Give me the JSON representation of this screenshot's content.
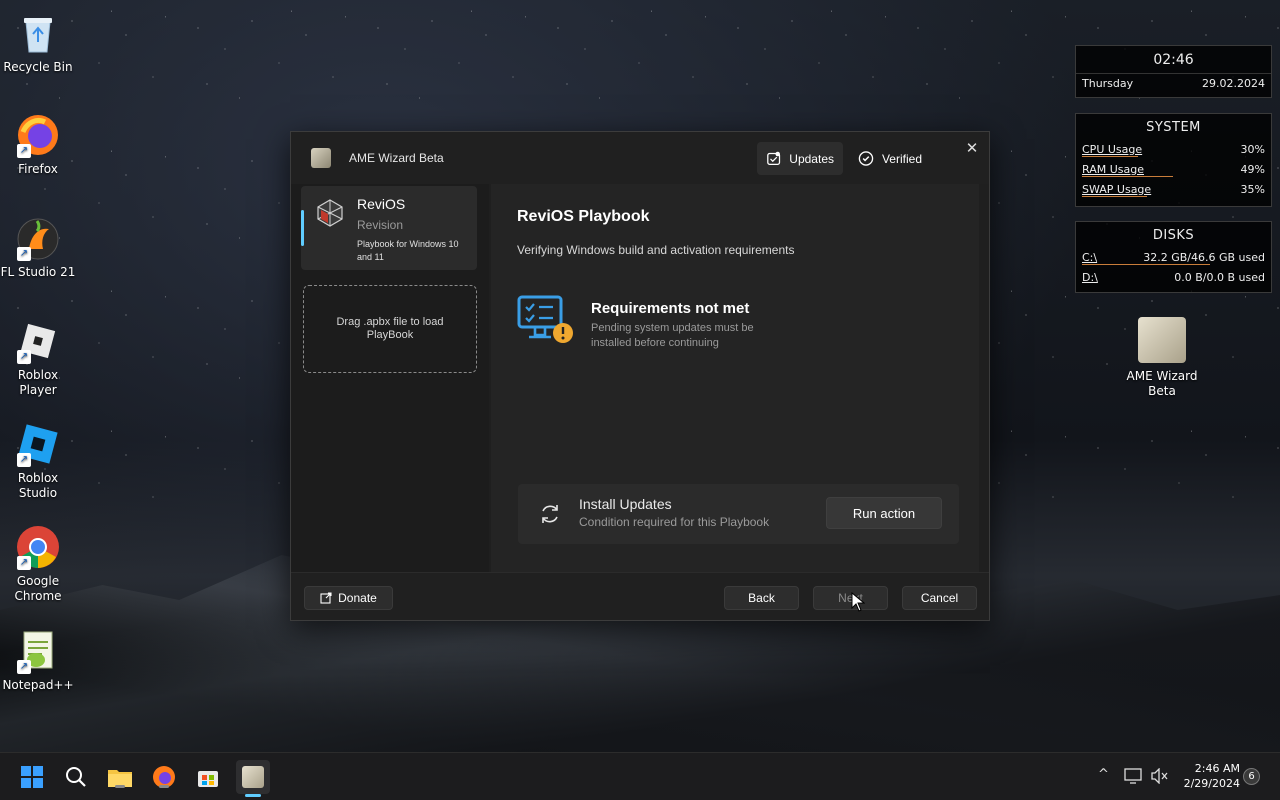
{
  "desktop": {
    "icons": [
      {
        "label": "Recycle Bin",
        "icon": "recycle-bin-icon"
      },
      {
        "label": "Firefox",
        "icon": "firefox-icon"
      },
      {
        "label": "FL Studio 21",
        "icon": "fl-studio-icon"
      },
      {
        "label": "Roblox Player",
        "icon": "roblox-player-icon"
      },
      {
        "label": "Roblox Studio",
        "icon": "roblox-studio-icon"
      },
      {
        "label": "Google Chrome",
        "icon": "chrome-icon"
      },
      {
        "label": "Notepad++",
        "icon": "notepad-plus-plus-icon"
      }
    ],
    "right_icon": {
      "label": "AME Wizard Beta",
      "icon": "ame-wizard-icon"
    }
  },
  "widgets": {
    "clock": {
      "time": "02:46",
      "day": "Thursday",
      "date": "29.02.2024"
    },
    "system": {
      "title": "SYSTEM",
      "rows": [
        {
          "label": "CPU Usage",
          "value": "30%",
          "level": 0.3
        },
        {
          "label": "RAM Usage",
          "value": "49%",
          "level": 0.49
        },
        {
          "label": "SWAP Usage",
          "value": "35%",
          "level": 0.35
        }
      ]
    },
    "disks": {
      "title": "DISKS",
      "rows": [
        {
          "label": "C:\\",
          "value": "32.2 GB/46.6 GB used",
          "level": 0.69
        },
        {
          "label": "D:\\",
          "value": "0.0 B/0.0 B used",
          "level": 0.0
        }
      ]
    }
  },
  "dialog": {
    "title": "AME Wizard Beta",
    "updates_label": "Updates",
    "verified_label": "Verified",
    "close_label": "✕",
    "playbook": {
      "name": "ReviOS",
      "subtitle": "Revision",
      "description": "Playbook for Windows 10 and 11"
    },
    "drop_zone": "Drag .apbx file to load PlayBook",
    "heading": "ReviOS Playbook",
    "status": "Verifying Windows build and activation requirements",
    "requirement": {
      "title": "Requirements not met",
      "description": "Pending system updates must be installed before continuing"
    },
    "action": {
      "title": "Install Updates",
      "subtitle": "Condition required for this Playbook",
      "button": "Run action"
    },
    "footer": {
      "donate": "Donate",
      "back": "Back",
      "next": "Next",
      "cancel": "Cancel"
    }
  },
  "taskbar": {
    "apps": [
      "start-icon",
      "search-icon",
      "file-explorer-icon",
      "firefox-icon",
      "microsoft-store-icon",
      "ame-wizard-icon"
    ],
    "time": "2:46 AM",
    "date": "2/29/2024",
    "notifications": "6"
  },
  "colors": {
    "accent": "#60cdff",
    "widget_bar": "#c97d3a",
    "dialog_bg": "#202020",
    "warning": "#f0a830"
  }
}
